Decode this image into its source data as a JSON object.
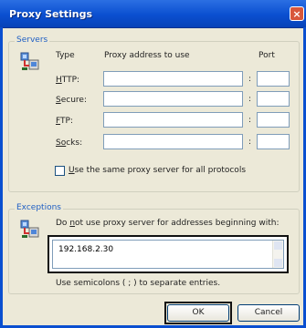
{
  "window": {
    "title": "Proxy Settings",
    "close_glyph": "×"
  },
  "servers": {
    "group_title": "Servers",
    "col_type": "Type",
    "col_address": "Proxy address to use",
    "col_port": "Port",
    "rows": [
      {
        "mnemonic": "H",
        "rest": "TTP:",
        "address": "",
        "port": ""
      },
      {
        "mnemonic": "S",
        "rest": "ecure:",
        "address": "",
        "port": ""
      },
      {
        "mnemonic": "F",
        "rest": "TP:",
        "address": "",
        "port": ""
      },
      {
        "mnemonic": "So",
        "rest": "cks:",
        "address": "",
        "port": ""
      }
    ],
    "same_proxy_mnemonic": "U",
    "same_proxy_rest": "se the same proxy server for all protocols",
    "colon": ":"
  },
  "exceptions": {
    "group_title": "Exceptions",
    "desc_pre": "Do ",
    "desc_mnemonic": "n",
    "desc_post": "ot use proxy server for addresses beginning with:",
    "value": "192.168.2.30",
    "hint": "Use semicolons ( ; ) to separate entries."
  },
  "buttons": {
    "ok": "OK",
    "cancel": "Cancel"
  },
  "icons": {
    "servers": "network-computer-icon",
    "exceptions": "network-computer-icon"
  }
}
